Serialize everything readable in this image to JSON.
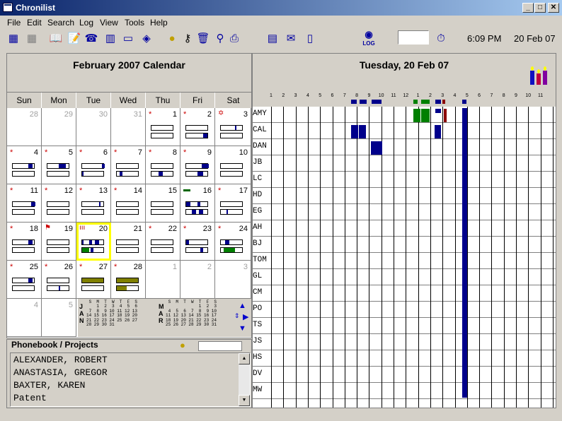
{
  "window": {
    "title": "Chronilist",
    "min": "_",
    "max": "□",
    "close": "✕"
  },
  "menu": [
    "File",
    "Edit",
    "Search",
    "Log",
    "View",
    "Tools",
    "Help"
  ],
  "toolbar": {
    "log_label": "LOG"
  },
  "status": {
    "time": "6:09 PM",
    "date": "20 Feb 07"
  },
  "calendar": {
    "title": "February 2007 Calendar",
    "dow": [
      "Sun",
      "Mon",
      "Tue",
      "Wed",
      "Thu",
      "Fri",
      "Sat"
    ],
    "days": [
      {
        "n": "28",
        "gray": true
      },
      {
        "n": "29",
        "gray": true
      },
      {
        "n": "30",
        "gray": true
      },
      {
        "n": "31",
        "gray": true
      },
      {
        "n": "1",
        "star": true
      },
      {
        "n": "2",
        "star": true
      },
      {
        "n": "3",
        "icon": "star-of-david"
      },
      {
        "n": "4",
        "star": true
      },
      {
        "n": "5",
        "star": true
      },
      {
        "n": "6",
        "star": true
      },
      {
        "n": "7",
        "star": true
      },
      {
        "n": "8",
        "star": true
      },
      {
        "n": "9",
        "star": true
      },
      {
        "n": "10"
      },
      {
        "n": "11",
        "star": true
      },
      {
        "n": "12",
        "star": true
      },
      {
        "n": "13",
        "star": true
      },
      {
        "n": "14",
        "star": true
      },
      {
        "n": "15"
      },
      {
        "n": "16",
        "icon": "computer"
      },
      {
        "n": "17",
        "star": true
      },
      {
        "n": "18",
        "star": true
      },
      {
        "n": "19",
        "icon": "flag"
      },
      {
        "n": "20",
        "icon": "candles"
      },
      {
        "n": "21"
      },
      {
        "n": "22",
        "star": true
      },
      {
        "n": "23",
        "star": true
      },
      {
        "n": "24",
        "star": true
      },
      {
        "n": "25",
        "star": true
      },
      {
        "n": "26",
        "star": true
      },
      {
        "n": "27",
        "star": true
      },
      {
        "n": "28",
        "star": true
      },
      {
        "n": "1",
        "gray": true
      },
      {
        "n": "2",
        "gray": true
      },
      {
        "n": "3",
        "gray": true
      },
      {
        "n": "4",
        "gray": true
      },
      {
        "n": "5",
        "gray": true
      }
    ],
    "mini": {
      "left_letters": "J\nA\nN",
      "right_letters": "M\nA\nR",
      "left_grid": " S  M  T  W  T  F  S\n    1  2  3  4  5  6\n 7  8  9 10 11 12 13\n14 15 16 17 18 19 20\n21 22 23 24 25 26 27\n28 29 30 31",
      "right_grid": " S  M  T  W  T  F  S\n             1  2  3\n 4  5  6  7  8  9 10\n11 12 13 14 15 16 17\n18 19 20 21 22 23 24\n25 26 27 28 29 30 31"
    }
  },
  "phonebook": {
    "title": "Phonebook / Projects",
    "items": [
      "ALEXANDER, ROBERT",
      "ANASTASIA, GREGOR",
      "BAXTER, KAREN",
      "Patent"
    ]
  },
  "schedule": {
    "title": "Tuesday, 20 Feb 07",
    "hours": [
      "1",
      "2",
      "3",
      "4",
      "5",
      "6",
      "7",
      "8",
      "9",
      "10",
      "11",
      "12",
      "1",
      "2",
      "3",
      "4",
      "5",
      "6",
      "7",
      "8",
      "9",
      "10",
      "11"
    ],
    "people": [
      "AMY",
      "CAL",
      "DAN",
      "JB",
      "LC",
      "HD",
      "EG",
      "AH",
      "BJ",
      "TOM",
      "GL",
      "CM",
      "PO",
      "TS",
      "JS",
      "HS",
      "DV",
      "MW"
    ]
  },
  "colors": {
    "accent": "#00008b",
    "green": "#008000",
    "olive": "#808000",
    "highlight": "#ffff00"
  }
}
